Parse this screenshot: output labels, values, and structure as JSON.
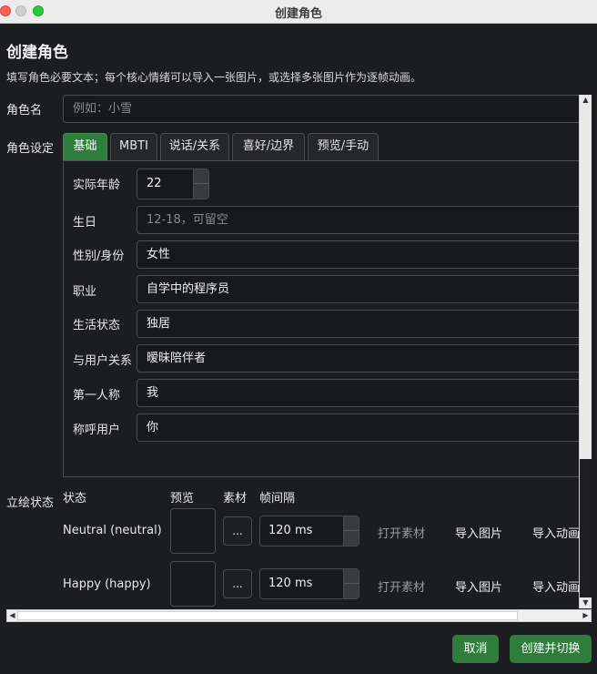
{
  "window": {
    "title": "创建角色"
  },
  "heading": "创建角色",
  "subheading": "填写角色必要文本；每个核心情绪可以导入一张图片，或选择多张图片作为逐帧动画。",
  "name_field": {
    "label": "角色名",
    "placeholder": "例如：小雪"
  },
  "settings": {
    "label": "角色设定",
    "tabs": [
      {
        "label": "基础",
        "active": true
      },
      {
        "label": "MBTI"
      },
      {
        "label": "说话/关系"
      },
      {
        "label": "喜好/边界"
      },
      {
        "label": "预览/手动"
      }
    ],
    "fields": {
      "age": {
        "label": "实际年龄",
        "value": "22"
      },
      "birthday": {
        "label": "生日",
        "placeholder": "12-18，可留空"
      },
      "gender": {
        "label": "性别/身份",
        "value": "女性"
      },
      "job": {
        "label": "职业",
        "value": "自学中的程序员"
      },
      "living": {
        "label": "生活状态",
        "value": "独居"
      },
      "relation": {
        "label": "与用户关系",
        "value": "暧昧陪伴者"
      },
      "first_person": {
        "label": "第一人称",
        "value": "我"
      },
      "call_user": {
        "label": "称呼用户",
        "value": "你"
      }
    }
  },
  "stand": {
    "label": "立绘状态",
    "columns": {
      "state": "状态",
      "preview": "预览",
      "asset": "素材",
      "interval": "帧间隔"
    },
    "rows": [
      {
        "name": "Neutral (neutral)",
        "browse": "...",
        "interval": "120 ms",
        "open": "打开素材",
        "import_image": "导入图片",
        "import_anim": "导入动画"
      },
      {
        "name": "Happy (happy)",
        "browse": "...",
        "interval": "120 ms",
        "open": "打开素材",
        "import_image": "导入图片",
        "import_anim": "导入动画"
      }
    ]
  },
  "buttons": {
    "cancel": "取消",
    "create": "创建并切换"
  },
  "colors": {
    "accent": "#2e7d3c",
    "background": "#1c1d21"
  }
}
